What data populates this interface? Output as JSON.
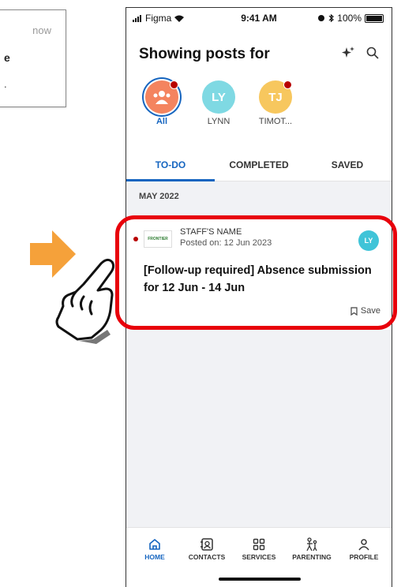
{
  "notification": {
    "time": "now",
    "fragment_1": "e",
    "fragment_2": "."
  },
  "status_bar": {
    "carrier": "Figma",
    "time": "9:41 AM",
    "battery": "100%"
  },
  "header": {
    "title": "Showing posts for"
  },
  "avatars": [
    {
      "initials": "",
      "label": "All",
      "color": "#f4845f",
      "active": true,
      "unread": true
    },
    {
      "initials": "LY",
      "label": "LYNN",
      "color": "#7fd9e3",
      "active": false,
      "unread": false
    },
    {
      "initials": "TJ",
      "label": "TIMOT...",
      "color": "#f7c75e",
      "active": false,
      "unread": true
    }
  ],
  "tabs": [
    {
      "label": "TO-DO",
      "active": true
    },
    {
      "label": "COMPLETED",
      "active": false
    },
    {
      "label": "SAVED",
      "active": false
    }
  ],
  "section_header": "MAY 2022",
  "post": {
    "logo_text": "FRONTIER",
    "sender": "STAFF'S NAME",
    "posted_on": "Posted on: 12 Jun 2023",
    "avatar_initials": "LY",
    "title": "[Follow-up required] Absence submission for 12 Jun - 14 Jun",
    "save_label": "Save"
  },
  "bottom_nav": [
    {
      "label": "HOME",
      "icon": "home-icon",
      "active": true
    },
    {
      "label": "CONTACTS",
      "icon": "contacts-icon",
      "active": false
    },
    {
      "label": "SERVICES",
      "icon": "services-icon",
      "active": false
    },
    {
      "label": "PARENTING",
      "icon": "parenting-icon",
      "active": false
    },
    {
      "label": "PROFILE",
      "icon": "profile-icon",
      "active": false
    }
  ],
  "colors": {
    "accent": "#1565c0",
    "highlight": "#e8000b",
    "arrow": "#f5a13a",
    "unread_dot": "#b80000"
  }
}
